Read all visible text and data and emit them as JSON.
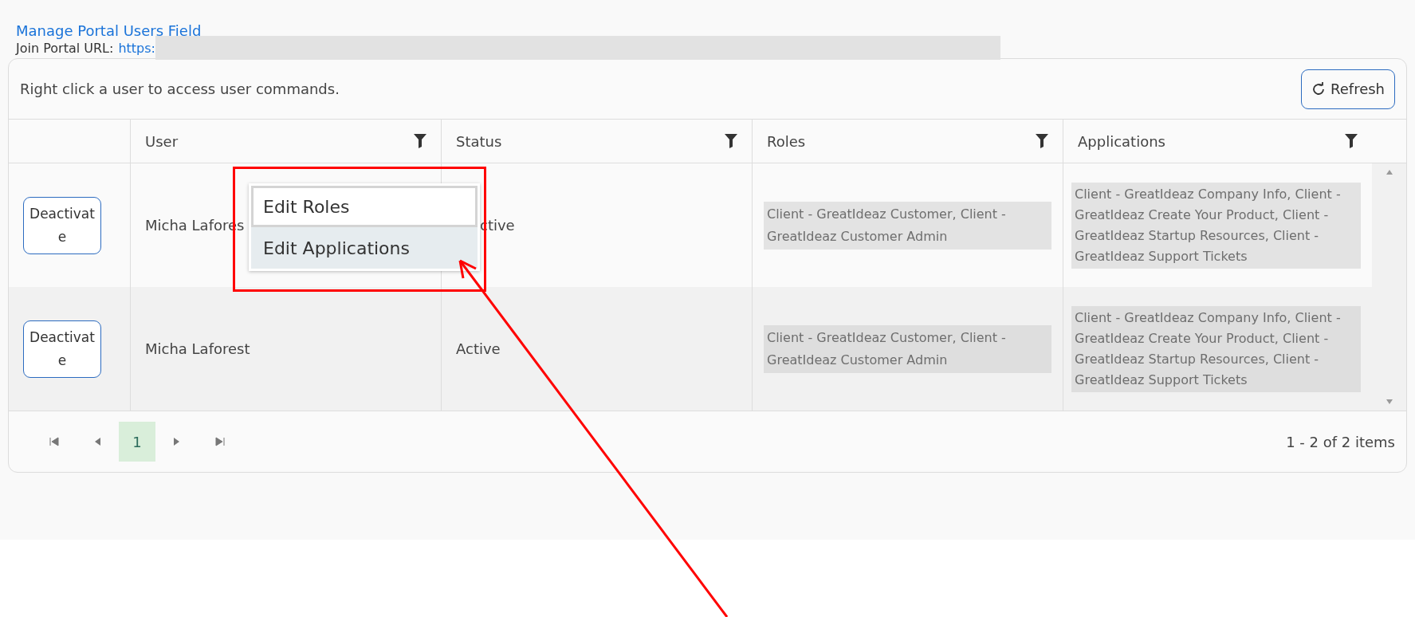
{
  "header": {
    "title": "Manage Portal Users Field",
    "url_label": "Join Portal URL:",
    "url_visible": "https:"
  },
  "toolbar": {
    "hint": "Right click a user to access user commands.",
    "refresh": "Refresh"
  },
  "table": {
    "columns": [
      {
        "label": "User"
      },
      {
        "label": "Status"
      },
      {
        "label": "Roles"
      },
      {
        "label": "Applications"
      }
    ],
    "rows": [
      {
        "action": "Deactivate",
        "user": "Micha Lafores",
        "status": "ctive",
        "under_menu": true,
        "roles": "Client - GreatIdeaz Customer, Client - GreatIdeaz Customer Admin",
        "applications": "Client - GreatIdeaz Company Info, Client - GreatIdeaz Create Your Product, Client - GreatIdeaz Startup Resources, Client - GreatIdeaz Support Tickets"
      },
      {
        "action": "Deactivate",
        "user": "Micha Laforest",
        "status": "Active",
        "under_menu": false,
        "roles": "Client - GreatIdeaz Customer, Client - GreatIdeaz Customer Admin",
        "applications": "Client - GreatIdeaz Company Info, Client - GreatIdeaz Create Your Product, Client - GreatIdeaz Startup Resources, Client - GreatIdeaz Support Tickets"
      }
    ]
  },
  "pager": {
    "pages": [
      {
        "label": "1",
        "selected": true
      }
    ],
    "summary": "1 - 2 of 2 items"
  },
  "context_menu": {
    "items": [
      {
        "label": "Edit Roles",
        "focused": true,
        "selected": false
      },
      {
        "label": "Edit Applications",
        "focused": false,
        "selected": true
      }
    ]
  }
}
